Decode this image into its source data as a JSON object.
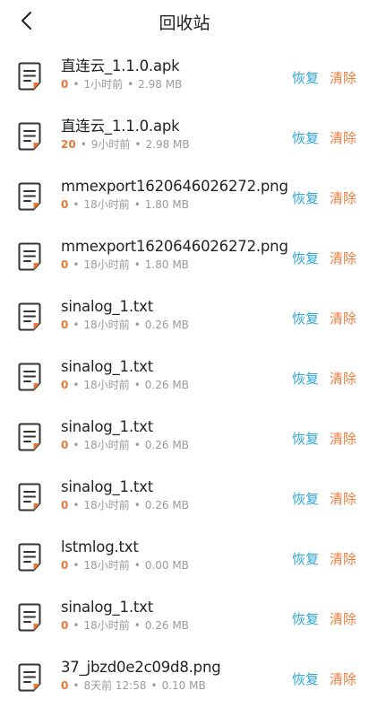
{
  "header": {
    "title": "回收站"
  },
  "colors": {
    "restore": "#2fa6d8",
    "clear": "#ef7d3e",
    "count": "#e8793a",
    "meta": "#9a9a9a"
  },
  "actions": {
    "restore_label": "恢复",
    "clear_label": "清除"
  },
  "items": [
    {
      "name": "直连云_1.1.0.apk",
      "count": "0",
      "time": "1小时前",
      "size": "2.98 MB",
      "icon": "document-icon"
    },
    {
      "name": "直连云_1.1.0.apk",
      "count": "20",
      "time": "9小时前",
      "size": "2.98 MB",
      "icon": "document-icon"
    },
    {
      "name": "mmexport1620646026272.png",
      "count": "0",
      "time": "18小时前",
      "size": "1.80 MB",
      "icon": "document-icon"
    },
    {
      "name": "mmexport1620646026272.png",
      "count": "0",
      "time": "18小时前",
      "size": "1.80 MB",
      "icon": "document-icon"
    },
    {
      "name": "sinalog_1.txt",
      "count": "0",
      "time": "18小时前",
      "size": "0.26 MB",
      "icon": "document-icon"
    },
    {
      "name": "sinalog_1.txt",
      "count": "0",
      "time": "18小时前",
      "size": "0.26 MB",
      "icon": "document-icon"
    },
    {
      "name": "sinalog_1.txt",
      "count": "0",
      "time": "18小时前",
      "size": "0.26 MB",
      "icon": "document-icon"
    },
    {
      "name": "sinalog_1.txt",
      "count": "0",
      "time": "18小时前",
      "size": "0.26 MB",
      "icon": "document-icon"
    },
    {
      "name": "lstmlog.txt",
      "count": "0",
      "time": "18小时前",
      "size": "0.00 MB",
      "icon": "document-icon"
    },
    {
      "name": "sinalog_1.txt",
      "count": "0",
      "time": "18小时前",
      "size": "0.26 MB",
      "icon": "document-icon"
    },
    {
      "name": "37_jbzd0e2c09d8.png",
      "count": "0",
      "time": "8天前 12:58",
      "size": "0.10 MB",
      "icon": "document-icon"
    }
  ]
}
